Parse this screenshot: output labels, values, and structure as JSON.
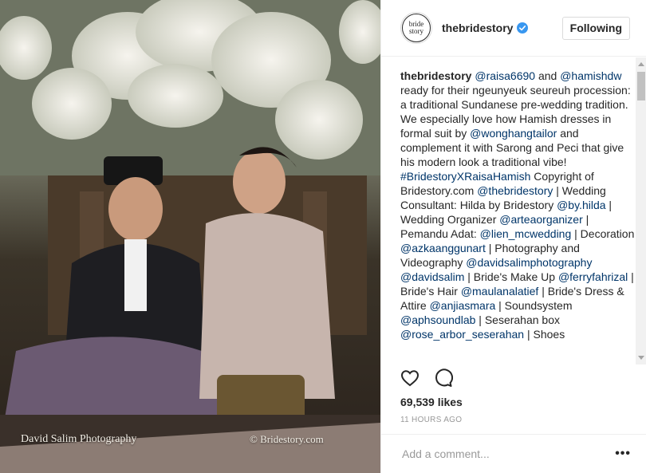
{
  "post": {
    "username": "thebridestory",
    "avatar_text": "bride story",
    "follow_label": "Following",
    "photo_watermark_left": "David Salim Photography",
    "photo_watermark_right": "© Bridestory.com",
    "caption_segments": [
      {
        "t": "u",
        "v": "thebridestory"
      },
      {
        "t": "n",
        "v": " "
      },
      {
        "t": "m",
        "v": "@raisa6690"
      },
      {
        "t": "n",
        "v": " and "
      },
      {
        "t": "m",
        "v": "@hamishdw"
      },
      {
        "t": "n",
        "v": " ready for their ngeunyeuk seureuh procession: a traditional Sundanese pre-wedding tradition. We especially love how Hamish dresses in formal suit by "
      },
      {
        "t": "m",
        "v": "@wonghangtailor"
      },
      {
        "t": "n",
        "v": " and complement it with Sarong and Peci that give his modern look a traditional vibe! "
      },
      {
        "t": "m",
        "v": "#BridestoryXRaisaHamish"
      },
      {
        "t": "n",
        "v": " Copyright of Bridestory.com "
      },
      {
        "t": "m",
        "v": "@thebridestory"
      },
      {
        "t": "n",
        "v": " | Wedding Consultant: Hilda by Bridestory "
      },
      {
        "t": "m",
        "v": "@by.hilda"
      },
      {
        "t": "n",
        "v": " | Wedding Organizer "
      },
      {
        "t": "m",
        "v": "@arteaorganizer"
      },
      {
        "t": "n",
        "v": " | Pemandu Adat: "
      },
      {
        "t": "m",
        "v": "@lien_mcwedding"
      },
      {
        "t": "n",
        "v": " | Decoration "
      },
      {
        "t": "m",
        "v": "@azkaanggunart"
      },
      {
        "t": "n",
        "v": " | Photography and Videography "
      },
      {
        "t": "m",
        "v": "@davidsalimphotography"
      },
      {
        "t": "n",
        "v": " "
      },
      {
        "t": "m",
        "v": "@davidsalim"
      },
      {
        "t": "n",
        "v": " | Bride's Make Up "
      },
      {
        "t": "m",
        "v": "@ferryfahrizal"
      },
      {
        "t": "n",
        "v": " | Bride's Hair "
      },
      {
        "t": "m",
        "v": "@maulanalatief"
      },
      {
        "t": "n",
        "v": " | Bride's Dress & Attire "
      },
      {
        "t": "m",
        "v": "@anjiasmara"
      },
      {
        "t": "n",
        "v": " | Soundsystem "
      },
      {
        "t": "m",
        "v": "@aphsoundlab"
      },
      {
        "t": "n",
        "v": " | Seserahan box "
      },
      {
        "t": "m",
        "v": "@rose_arbor_seserahan"
      },
      {
        "t": "n",
        "v": " | Shoes"
      }
    ],
    "likes": "69,539 likes",
    "timestamp": "11 HOURS AGO",
    "comment_placeholder": "Add a comment...",
    "more_label": "•••"
  },
  "colors": {
    "mention": "#003569",
    "verified": "#3897f0",
    "muted": "#999999"
  }
}
